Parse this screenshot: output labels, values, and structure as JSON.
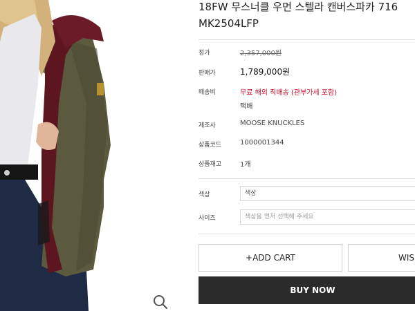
{
  "product": {
    "title_line1": "18FW 무스너클 우먼 스텔라 캔버스파카 716",
    "title_line2": "MK2504LFP"
  },
  "info": {
    "list_price_label": "정가",
    "list_price": "2,357,000원",
    "sale_price_label": "판매가",
    "sale_price": "1,789,000원",
    "shipping_label": "배송비",
    "shipping_value": "무료 해외 직배송 (관부가세 포함)",
    "shipping_method": "택배",
    "maker_label": "제조사",
    "maker": "MOOSE KNUCKLES",
    "code_label": "상품코드",
    "code": "1000001344",
    "stock_label": "상품재고",
    "stock": "1개"
  },
  "options": {
    "color_label": "색상",
    "color_value": "색상",
    "size_label": "사이즈",
    "size_placeholder": "색상을 먼저 선택해 주세요"
  },
  "actions": {
    "add_cart": "+ADD CART",
    "wish": "WIS",
    "buy_now": "BUY NOW"
  },
  "colors": {
    "accent_red": "#c8102e",
    "buy_button": "#2b2b2b",
    "jacket": "#5b5a3f",
    "fur": "#5d1620"
  },
  "icons": {
    "zoom": "magnifier-icon"
  }
}
